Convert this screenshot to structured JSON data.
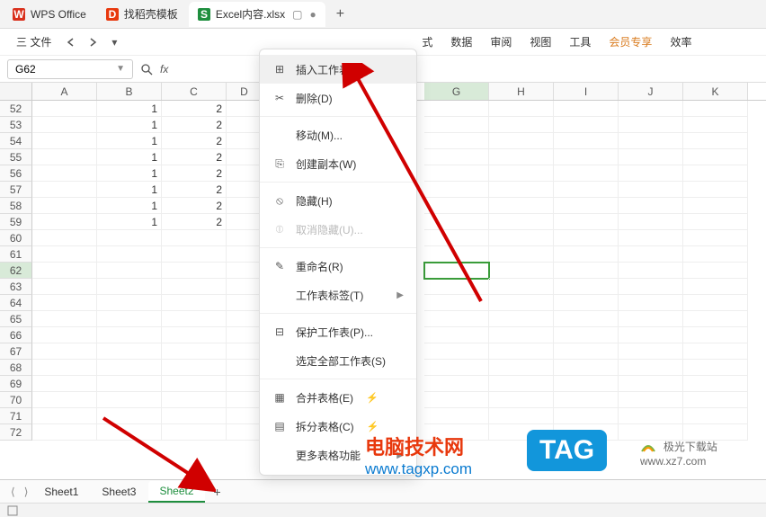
{
  "tabs": {
    "items": [
      {
        "label": "WPS Office",
        "icon": "wps"
      },
      {
        "label": "找稻壳模板",
        "icon": "docer"
      },
      {
        "label": "Excel内容.xlsx",
        "icon": "sheet",
        "active": true
      }
    ],
    "add": "+"
  },
  "menubar": {
    "file": "三 文件",
    "items": [
      "式",
      "数据",
      "审阅",
      "视图",
      "工具",
      "会员专享",
      "效率"
    ]
  },
  "formula_bar": {
    "cell_ref": "G62",
    "fx": "fx"
  },
  "columns": [
    "A",
    "B",
    "C",
    "D",
    "G",
    "H",
    "I",
    "J",
    "K"
  ],
  "active_col": "G",
  "rows": [
    {
      "n": 52,
      "b": "1",
      "c": "2"
    },
    {
      "n": 53,
      "b": "1",
      "c": "2"
    },
    {
      "n": 54,
      "b": "1",
      "c": "2"
    },
    {
      "n": 55,
      "b": "1",
      "c": "2"
    },
    {
      "n": 56,
      "b": "1",
      "c": "2"
    },
    {
      "n": 57,
      "b": "1",
      "c": "2"
    },
    {
      "n": 58,
      "b": "1",
      "c": "2"
    },
    {
      "n": 59,
      "b": "1",
      "c": "2"
    },
    {
      "n": 60,
      "b": "",
      "c": ""
    },
    {
      "n": 61,
      "b": "",
      "c": ""
    },
    {
      "n": 62,
      "b": "",
      "c": "",
      "active": true
    },
    {
      "n": 63,
      "b": "",
      "c": ""
    },
    {
      "n": 64,
      "b": "",
      "c": ""
    },
    {
      "n": 65,
      "b": "",
      "c": ""
    },
    {
      "n": 66,
      "b": "",
      "c": ""
    },
    {
      "n": 67,
      "b": "",
      "c": ""
    },
    {
      "n": 68,
      "b": "",
      "c": ""
    },
    {
      "n": 69,
      "b": "",
      "c": ""
    },
    {
      "n": 70,
      "b": "",
      "c": ""
    },
    {
      "n": 71,
      "b": "",
      "c": ""
    },
    {
      "n": 72,
      "b": "",
      "c": ""
    }
  ],
  "context_menu": {
    "items": [
      {
        "label": "插入工作表(I)...",
        "icon": "insert",
        "hover": true
      },
      {
        "label": "删除(D)",
        "icon": "delete"
      },
      {
        "sep": true
      },
      {
        "label": "移动(M)...",
        "icon": "blank"
      },
      {
        "label": "创建副本(W)",
        "icon": "copy"
      },
      {
        "sep": true
      },
      {
        "label": "隐藏(H)",
        "icon": "hide"
      },
      {
        "label": "取消隐藏(U)...",
        "icon": "unhide",
        "disabled": true
      },
      {
        "sep": true
      },
      {
        "label": "重命名(R)",
        "icon": "rename"
      },
      {
        "label": "工作表标签(T)",
        "icon": "blank",
        "sub": true
      },
      {
        "sep": true
      },
      {
        "label": "保护工作表(P)...",
        "icon": "protect"
      },
      {
        "label": "选定全部工作表(S)",
        "icon": "blank"
      },
      {
        "sep": true
      },
      {
        "label": "合并表格(E)",
        "icon": "merge",
        "bolt": true
      },
      {
        "label": "拆分表格(C)",
        "icon": "split",
        "bolt": true
      },
      {
        "label": "更多表格功能",
        "icon": "blank",
        "sub": true
      }
    ]
  },
  "sheet_tabs": {
    "items": [
      {
        "label": "Sheet1"
      },
      {
        "label": "Sheet3"
      },
      {
        "label": "Sheet2",
        "active": true
      }
    ],
    "add": "+",
    "nav_l": "⟨",
    "nav_r": "⟩"
  },
  "watermarks": {
    "w1_line1": "电脑技术网",
    "w1_line2": "www.tagxp.com",
    "tag": "TAG",
    "w2_line1": "极光下载站",
    "w2_line2": "www.xz7.com"
  }
}
